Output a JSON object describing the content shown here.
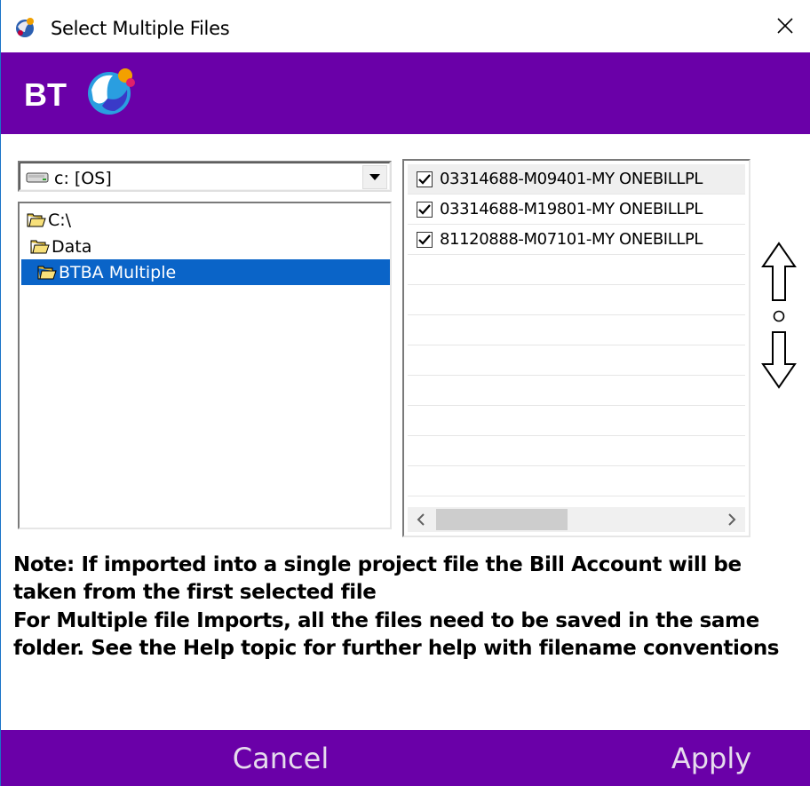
{
  "window": {
    "title": "Select Multiple Files"
  },
  "banner": {
    "brand": "BT",
    "background_color": "#6a00a8"
  },
  "drive_selector": {
    "selected": "c: [OS]"
  },
  "folder_tree": {
    "items": [
      {
        "label": "C:\\",
        "selected": false
      },
      {
        "label": "Data",
        "selected": false
      },
      {
        "label": "BTBA Multiple",
        "selected": true
      }
    ]
  },
  "file_list": {
    "items": [
      {
        "label": "03314688-M09401-MY ONEBILLPL",
        "checked": true
      },
      {
        "label": "03314688-M19801-MY ONEBILLPL",
        "checked": true
      },
      {
        "label": "81120888-M07101-MY ONEBILLPL",
        "checked": true
      }
    ]
  },
  "notes": {
    "note1": "Note: If imported into a single project file the Bill Account will be taken from the first selected file",
    "note2": "For Multiple file Imports, all the files need to be saved in the same folder. See the Help topic for further help with filename conventions"
  },
  "footer": {
    "cancel_label": "Cancel",
    "apply_label": "Apply"
  },
  "colors": {
    "brand_purple": "#6a00a8",
    "selection_blue": "#0a64c8"
  },
  "icons": {
    "app": "bt-globe-icon",
    "close": "close-icon",
    "drive": "drive-icon",
    "folder": "open-folder-icon",
    "move_up": "arrow-up-icon",
    "move_down": "arrow-down-icon"
  }
}
